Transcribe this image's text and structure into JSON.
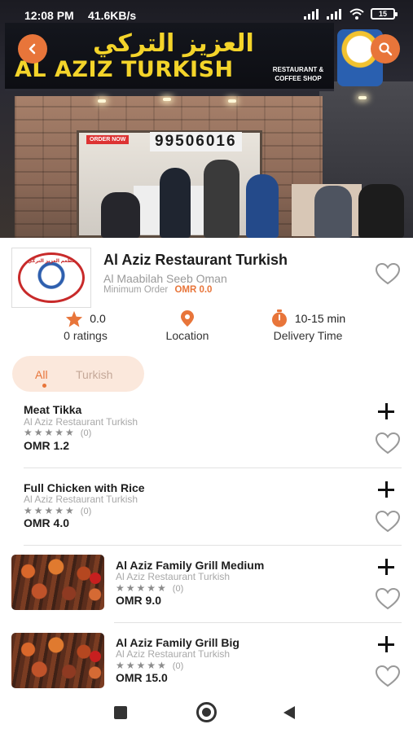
{
  "status_bar": {
    "time": "12:08 PM",
    "network_speed": "41.6KB/s",
    "battery": "15"
  },
  "hero": {
    "sign_arabic": "العزيز التركي",
    "sign_english": "AL AZIZ TURKISH",
    "sign_subtitle": "RESTAURANT & COFFEE SHOP",
    "shop_phone": "99506016",
    "order_now": "ORDER NOW",
    "back_icon": "chevron-left-icon",
    "search_icon": "search-icon"
  },
  "restaurant": {
    "name": "Al Aziz Restaurant Turkish",
    "address": "Al Maabilah Seeb Oman",
    "minimum_order_label": "Minimum Order",
    "minimum_order_value": "OMR 0.0",
    "logo_text": "مطعم العزيز التركي"
  },
  "stats": {
    "rating_value": "0.0",
    "rating_label": "0 ratings",
    "location_label": "Location",
    "delivery_value": "10-15 min",
    "delivery_label": "Delivery Time"
  },
  "tabs": [
    {
      "label": "All",
      "active": true
    },
    {
      "label": "Turkish",
      "active": false
    }
  ],
  "menu": [
    {
      "title": "Meat Tikka",
      "restaurant": "Al Aziz Restaurant Turkish",
      "rating": 0,
      "rating_count": "(0)",
      "price": "OMR 1.2",
      "has_image": false
    },
    {
      "title": "Full Chicken with Rice",
      "restaurant": "Al Aziz Restaurant Turkish",
      "rating": 0,
      "rating_count": "(0)",
      "price": "OMR 4.0",
      "has_image": false
    },
    {
      "title": "Al Aziz Family Grill Medium",
      "restaurant": "Al Aziz Restaurant Turkish",
      "rating": 0,
      "rating_count": "(0)",
      "price": "OMR 9.0",
      "has_image": true
    },
    {
      "title": "Al Aziz Family Grill Big",
      "restaurant": "Al Aziz Restaurant Turkish",
      "rating": 0,
      "rating_count": "(0)",
      "price": "OMR 15.0",
      "has_image": true
    }
  ],
  "colors": {
    "accent": "#e8753a",
    "tab_background": "#fbe8dc",
    "muted_text": "#a8a8a8"
  }
}
